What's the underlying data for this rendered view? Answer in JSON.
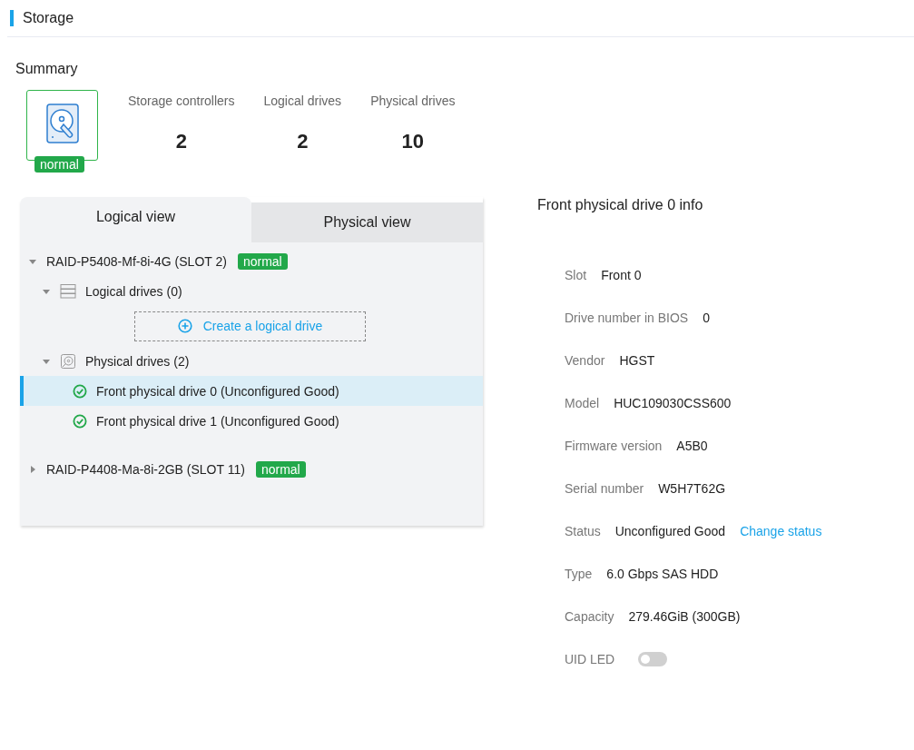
{
  "page": {
    "title": "Storage"
  },
  "summary": {
    "title": "Summary",
    "status": "normal",
    "stats": [
      {
        "label": "Storage controllers",
        "value": "2"
      },
      {
        "label": "Logical drives",
        "value": "2"
      },
      {
        "label": "Physical drives",
        "value": "10"
      }
    ]
  },
  "tabs": [
    {
      "label": "Logical view",
      "selected": true
    },
    {
      "label": "Physical view",
      "selected": false
    }
  ],
  "tree": [
    {
      "label": "RAID-P5408-Mf-8i-4G (SLOT 2)",
      "status": "normal",
      "expanded": true,
      "groups": [
        {
          "kind": "logical",
          "label": "Logical drives (0)",
          "expanded": true,
          "action": "Create a logical drive"
        },
        {
          "kind": "physical",
          "label": "Physical drives (2)",
          "expanded": true,
          "drives": [
            {
              "label": "Front physical drive 0 (Unconfigured Good)",
              "selected": true
            },
            {
              "label": "Front physical drive 1 (Unconfigured Good)",
              "selected": false
            }
          ]
        }
      ]
    },
    {
      "label": "RAID-P4408-Ma-8i-2GB (SLOT 11)",
      "status": "normal",
      "expanded": false
    }
  ],
  "info": {
    "title": "Front physical drive 0 info",
    "rows": [
      {
        "kind": "text",
        "label": "Slot",
        "value": "Front 0"
      },
      {
        "kind": "text",
        "label": "Drive number in BIOS",
        "value": "0"
      },
      {
        "kind": "text",
        "label": "Vendor",
        "value": "HGST"
      },
      {
        "kind": "text",
        "label": "Model",
        "value": "HUC109030CSS600"
      },
      {
        "kind": "text",
        "label": "Firmware version",
        "value": "A5B0"
      },
      {
        "kind": "text",
        "label": "Serial number",
        "value": "W5H7T62G"
      },
      {
        "kind": "link",
        "label": "Status",
        "value": "Unconfigured Good",
        "link": "Change status"
      },
      {
        "kind": "text",
        "label": "Type",
        "value": "6.0 Gbps SAS HDD"
      },
      {
        "kind": "text",
        "label": "Capacity",
        "value": "279.46GiB (300GB)"
      },
      {
        "kind": "toggle",
        "label": "UID LED",
        "on": false
      }
    ]
  }
}
